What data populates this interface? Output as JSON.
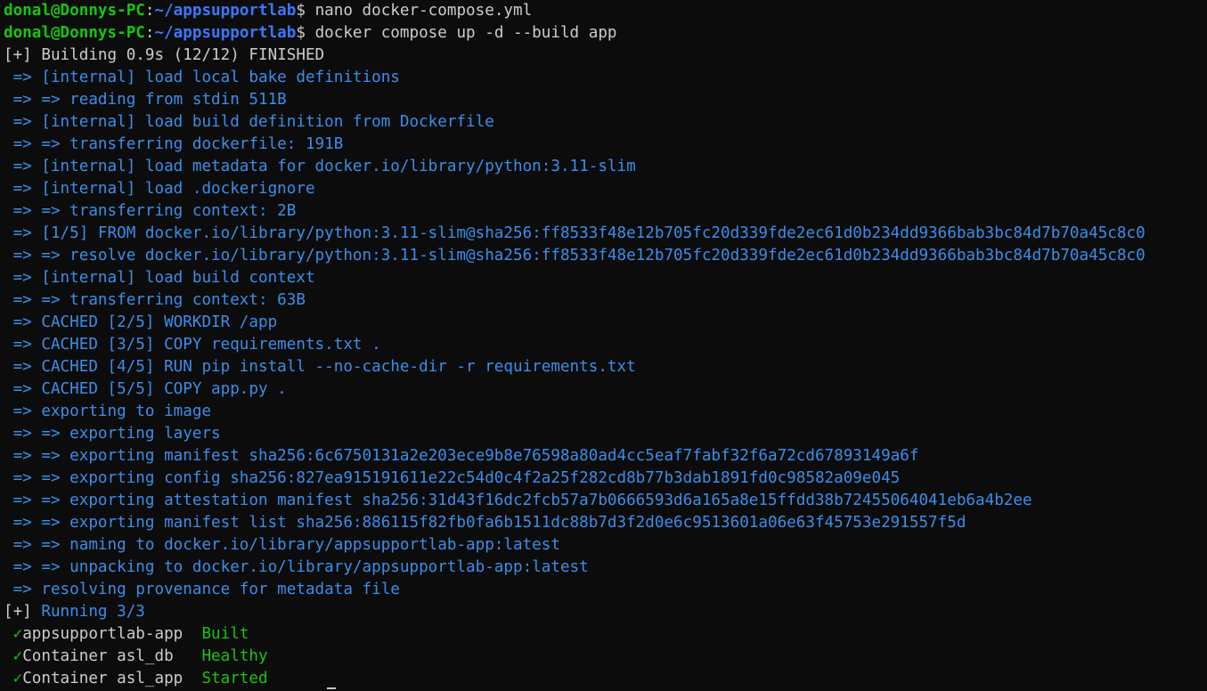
{
  "prompt1": {
    "user_host": "donal@Donnys-PC",
    "sep": ":",
    "path": "~/appsupportlab",
    "sign": "$ ",
    "command": "nano docker-compose.yml"
  },
  "prompt2": {
    "user_host": "donal@Donnys-PC",
    "sep": ":",
    "path": "~/appsupportlab",
    "sign": "$ ",
    "command": "docker compose up -d --build app"
  },
  "build_header": {
    "marker": "[+]",
    "text": " Building 0.9s (12/12) FINISHED"
  },
  "build_steps": [
    " => [internal] load local bake definitions",
    " => => reading from stdin 511B",
    " => [internal] load build definition from Dockerfile",
    " => => transferring dockerfile: 191B",
    " => [internal] load metadata for docker.io/library/python:3.11-slim",
    " => [internal] load .dockerignore",
    " => => transferring context: 2B",
    " => [1/5] FROM docker.io/library/python:3.11-slim@sha256:ff8533f48e12b705fc20d339fde2ec61d0b234dd9366bab3bc84d7b70a45c8c0",
    " => => resolve docker.io/library/python:3.11-slim@sha256:ff8533f48e12b705fc20d339fde2ec61d0b234dd9366bab3bc84d7b70a45c8c0",
    " => [internal] load build context",
    " => => transferring context: 63B",
    " => CACHED [2/5] WORKDIR /app",
    " => CACHED [3/5] COPY requirements.txt .",
    " => CACHED [4/5] RUN pip install --no-cache-dir -r requirements.txt",
    " => CACHED [5/5] COPY app.py .",
    " => exporting to image",
    " => => exporting layers",
    " => => exporting manifest sha256:6c6750131a2e203ece9b8e76598a80ad4cc5eaf7fabf32f6a72cd67893149a6f",
    " => => exporting config sha256:827ea915191611e22c54d0c4f2a25f282cd8b77b3dab1891fd0c98582a09e045",
    " => => exporting attestation manifest sha256:31d43f16dc2fcb57a7b0666593d6a165a8e15ffdd38b72455064041eb6a4b2ee",
    " => => exporting manifest list sha256:886115f82fb0fa6b1511dc88b7d3f2d0e6c9513601a06e63f45753e291557f5d",
    " => => naming to docker.io/library/appsupportlab-app:latest",
    " => => unpacking to docker.io/library/appsupportlab-app:latest",
    " => resolving provenance for metadata file"
  ],
  "running_header": {
    "marker": "[+]",
    "text": " Running 3/3"
  },
  "results": [
    {
      "check": " ✓",
      "name": "appsupportlab-app",
      "pad": "  ",
      "status": "Built"
    },
    {
      "check": " ✓",
      "name": "Container asl_db",
      "pad": "   ",
      "status": "Healthy"
    },
    {
      "check": " ✓",
      "name": "Container asl_app",
      "pad": "  ",
      "status": "Started"
    }
  ]
}
